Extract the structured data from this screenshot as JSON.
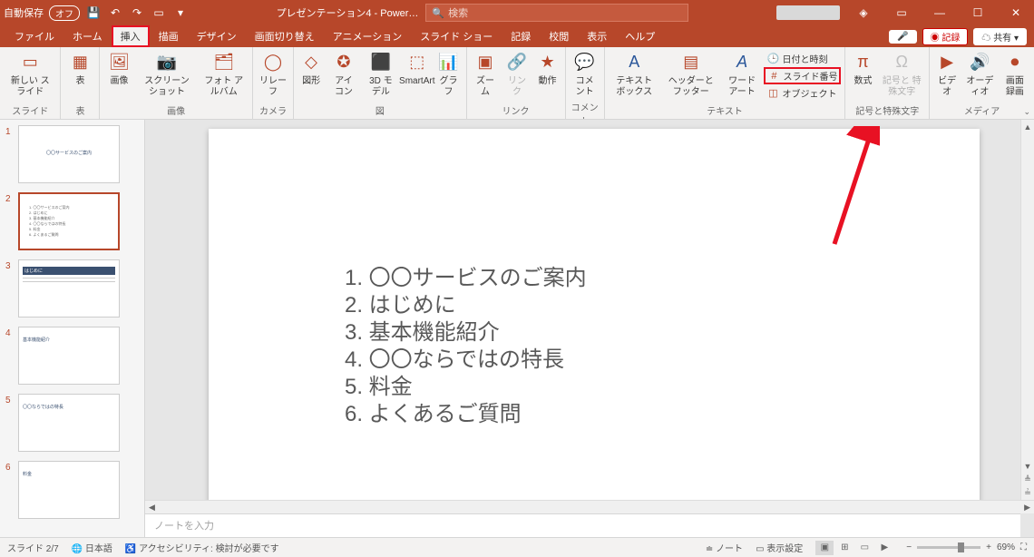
{
  "titlebar": {
    "autosave_label": "自動保存",
    "autosave_state": "オフ",
    "doc_title": "プレゼンテーション4 - Power…",
    "search_placeholder": "検索"
  },
  "tabs": {
    "file": "ファイル",
    "home": "ホーム",
    "insert": "挿入",
    "draw": "描画",
    "design": "デザイン",
    "transitions": "画面切り替え",
    "animations": "アニメーション",
    "slideshow": "スライド ショー",
    "record": "記録",
    "review": "校閲",
    "view": "表示",
    "help": "ヘルプ",
    "record_btn": "◉ 記録",
    "share_btn": "共有"
  },
  "ribbon": {
    "g_slides_label": "スライド",
    "new_slide": "新しい\nスライド",
    "g_tables_label": "表",
    "table": "表",
    "g_images_label": "画像",
    "image": "画像",
    "screenshot": "スクリーン\nショット",
    "photo_album": "フォト\nアルバム",
    "g_camera_label": "カメラ",
    "cameo": "リレー\nフ",
    "g_illust_label": "図",
    "shapes": "図形",
    "icons": "アイ\nコン",
    "model3d": "3D\nモデル",
    "smartart": "SmartArt",
    "chart": "グラフ",
    "g_link_label": "リンク",
    "zoom": "ズーム",
    "link": "リンク",
    "action": "動作",
    "g_comment_label": "コメント",
    "comment": "コメント",
    "g_text_label": "テキスト",
    "textbox": "テキスト\nボックス",
    "header_footer": "ヘッダーと\nフッター",
    "wordart": "ワード\nアート",
    "datetime": "日付と時刻",
    "slide_number": "スライド番号",
    "object": "オブジェクト",
    "g_symbol_label": "記号と特殊文字",
    "equation": "数式",
    "symbol": "記号と\n特殊文字",
    "g_media_label": "メディア",
    "video": "ビデオ",
    "audio": "オーディオ",
    "screen_rec": "画面\n録画"
  },
  "thumbs": {
    "t1": "〇〇サービスのご案内",
    "t2_1": "1. 〇〇サービスのご案内",
    "t2_2": "2. はじめに",
    "t2_3": "3. 基本機能紹介",
    "t2_4": "4. 〇〇ならではの特長",
    "t2_5": "5. 料金",
    "t2_6": "6. よくあるご質問",
    "t3": "はじめに",
    "t4": "基本機能紹介",
    "t5": "〇〇ならではの特長",
    "t6": "料金"
  },
  "slide_content": {
    "items": [
      "1.  〇〇サービスのご案内",
      "2.  はじめに",
      "3.  基本機能紹介",
      "4.  〇〇ならではの特長",
      "5.  料金",
      "6.  よくあるご質問"
    ]
  },
  "notes": {
    "placeholder": "ノートを入力"
  },
  "status": {
    "slide_pos": "スライド 2/7",
    "lang": "日本語",
    "accessibility": "アクセシビリティ: 検討が必要です",
    "notes_btn": "ノート",
    "display_settings": "表示設定",
    "zoom_pct": "69%"
  }
}
